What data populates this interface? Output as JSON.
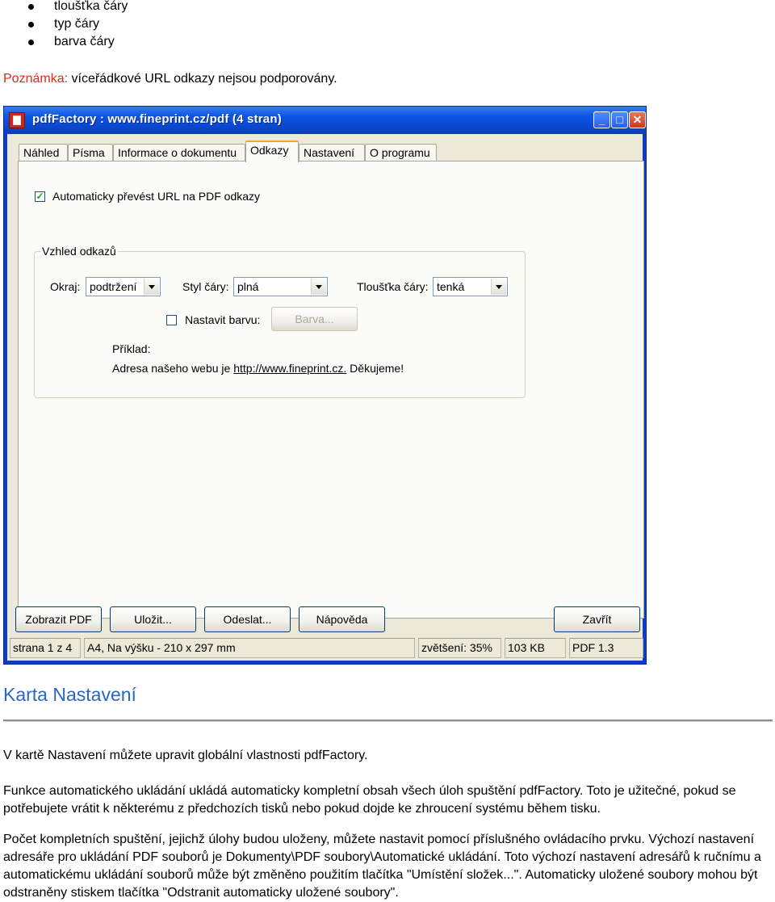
{
  "bullets": [
    "tloušťka čáry",
    "typ čáry",
    "barva čáry"
  ],
  "note": {
    "label": "Poznámka:",
    "text": " víceřádkové URL odkazy nejsou podporovány."
  },
  "window": {
    "title": "pdfFactory : www.fineprint.cz/pdf (4 stran)",
    "buttons": {
      "minimize": "_",
      "maximize": "□",
      "close": "✕"
    },
    "tabs": [
      "Náhled",
      "Písma",
      "Informace o dokumentu",
      "Odkazy",
      "Nastavení",
      "O programu"
    ],
    "active_tab": "Odkazy",
    "auto_convert_label": "Automaticky převést URL na PDF odkazy",
    "auto_convert_checked": true,
    "group_title": "Vzhled odkazů",
    "border_label": "Okraj:",
    "border_value": "podtržení",
    "line_style_label": "Styl čáry:",
    "line_style_value": "plná",
    "line_width_label": "Tloušťka čáry:",
    "line_width_value": "tenká",
    "set_color_label": "Nastavit barvu:",
    "set_color_checked": false,
    "color_button": "Barva...",
    "example_label": "Příklad:",
    "example_prefix": "Adresa našeho webu je ",
    "example_link": "http://www.fineprint.cz.",
    "example_suffix": " Děkujeme!",
    "bottom_buttons": {
      "show": "Zobrazit PDF",
      "save": "Uložit...",
      "send": "Odeslat...",
      "help": "Nápověda",
      "close": "Zavřít"
    },
    "status": {
      "page": "strana 1 z 4",
      "paper": "A4, Na výšku - 210 x 297 mm",
      "zoom": "zvětšení: 35%",
      "size": "103 KB",
      "version": "PDF 1.3"
    }
  },
  "section": {
    "heading": "Karta Nastavení",
    "paragraphs": [
      "V kartě Nastavení můžete upravit globální vlastnosti pdfFactory.",
      "Funkce automatického ukládání ukládá automaticky kompletní obsah všech úloh spuštění pdfFactory. Toto je užitečné, pokud se potřebujete vrátit k některému z předchozích tisků nebo pokud dojde ke zhroucení systému během tisku.",
      "Počet kompletních spuštění, jejichž úlohy budou uloženy, můžete nastavit pomocí příslušného ovládacího prvku. Výchozí nastavení adresáře pro ukládání PDF souborů je Dokumenty\\PDF soubory\\Automatické ukládání. Toto výchozí nastavení adresářů k ručnímu a automatickému ukládání souborů může být změněno použitím tlačítka \"Umístění složek...\". Automaticky uložené soubory mohou být odstraněny stiskem tlačítka \"Odstranit automaticky uložené soubory\"."
    ]
  },
  "colors": {
    "heading": "#2a66c4",
    "note_label": "#e0281b",
    "titlebar": "#0a49d3",
    "dialog_bg": "#ece9d8"
  }
}
